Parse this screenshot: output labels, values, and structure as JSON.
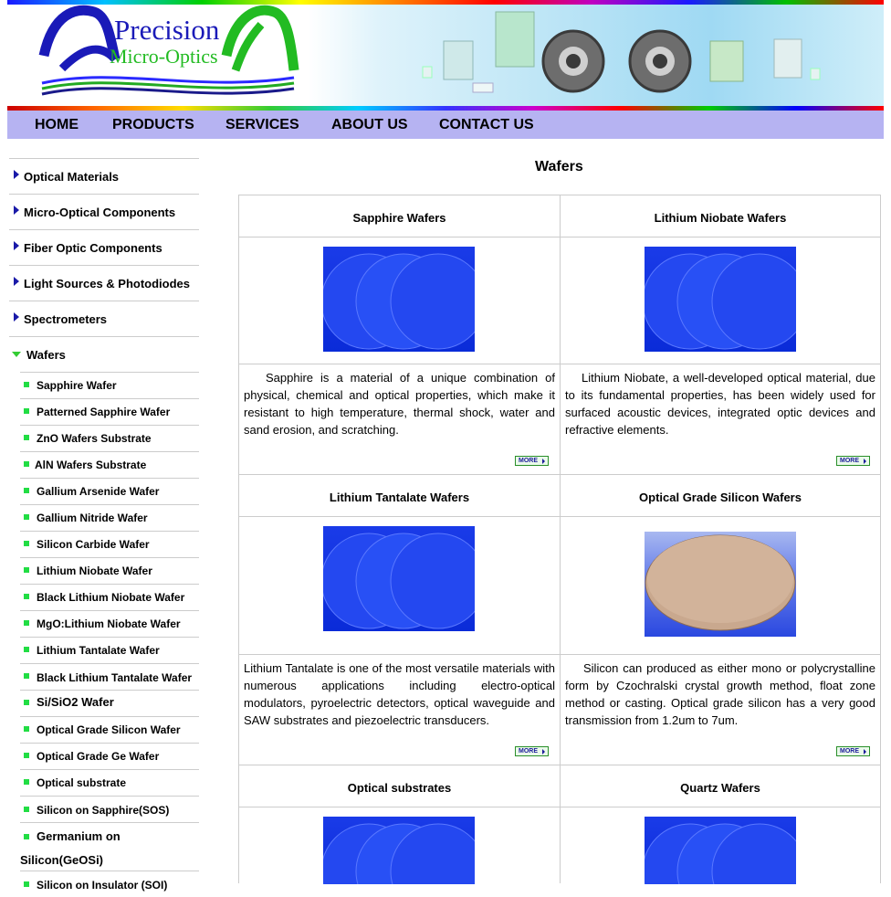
{
  "brand": {
    "line1": "Precision",
    "line2": "Micro-Optics"
  },
  "nav": [
    "HOME",
    "PRODUCTS",
    "SERVICES",
    "ABOUT US",
    "CONTACT US"
  ],
  "sidebar": {
    "categories": [
      "Optical Materials",
      "Micro-Optical Components",
      "Fiber Optic Components",
      "Light Sources & Photodiodes",
      "Spectrometers"
    ],
    "active_category": "Wafers",
    "subitems": [
      "Sapphire Wafer",
      "Patterned Sapphire Wafer",
      "ZnO Wafers Substrate",
      "AlN Wafers Substrate",
      "Gallium Arsenide Wafer",
      "Gallium Nitride Wafer",
      "Silicon Carbide Wafer",
      "Lithium Niobate Wafer",
      "Black Lithium Niobate Wafer",
      "MgO:Lithium Niobate Wafer",
      "Lithium Tantalate Wafer",
      "Black Lithium Tantalate Wafer",
      "Si/SiO2 Wafer",
      "Optical Grade Silicon Wafer",
      "Optical Grade Ge Wafer",
      "Optical substrate",
      "Silicon on Sapphire(SOS)",
      "Germanium on",
      "Silicon(GeOSi)",
      "Silicon on Insulator (SOI)"
    ]
  },
  "main": {
    "title": "Wafers",
    "more_label": "MORE",
    "products": [
      {
        "name": "Sapphire Wafers",
        "desc": "Sapphire is a material of a unique combination of physical, chemical and optical properties, which make it resistant to high temperature, thermal shock, water and sand erosion, and scratching."
      },
      {
        "name": "Lithium Niobate Wafers",
        "desc": "Lithium Niobate, a well-developed optical material, due to its fundamental properties, has been widely used for surfaced acoustic devices, integrated optic devices and refractive elements."
      },
      {
        "name": "Lithium Tantalate Wafers",
        "desc": "Lithium Tantalate is one of the most versatile materials with numerous applications including electro-optical modulators, pyroelectric detectors, optical waveguide and SAW substrates and piezoelectric transducers."
      },
      {
        "name": "Optical Grade Silicon Wafers",
        "desc": "Silicon can produced as either mono or polycrystalline form by Czochralski crystal growth method, float zone method or casting. Optical grade silicon has a very good transmission from 1.2um to 7um."
      },
      {
        "name": "Optical substrates",
        "desc": ""
      },
      {
        "name": "Quartz Wafers",
        "desc": ""
      }
    ]
  }
}
